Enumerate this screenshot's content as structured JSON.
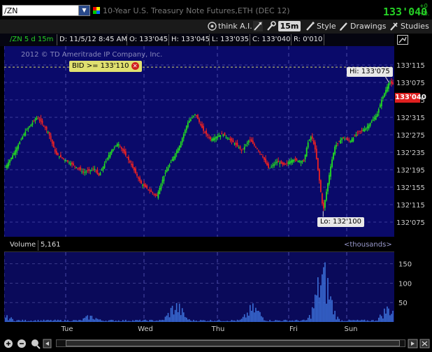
{
  "header": {
    "symbol": "/ZN",
    "description": "10-Year U.S. Treasury Note Futures,ETH (DEC 12)",
    "last_price": "133'040",
    "change_line1": "+0",
    "change_line2": "+0.",
    "price_color": "#25d025"
  },
  "toolbar": {
    "thinkai_label": "think A.I.",
    "timeframe_label": "15m",
    "style_label": "Style",
    "drawings_label": "Drawings",
    "studies_label": "Studies"
  },
  "infobar": {
    "chart_label": "/ZN 5 d 15m",
    "date": "D: 11/5/12 8:45 AM",
    "open": "O: 133'045",
    "high": "H: 133'045",
    "low": "L: 133'035",
    "close": "C: 133'040",
    "range": "R: 0'010"
  },
  "watermark": "2012 © TD Ameritrade IP Company, Inc.",
  "alert": {
    "label": "BID >= 133'110"
  },
  "chart_data": {
    "type": "candlestick",
    "y_ticks": [
      "133'115",
      "133'075",
      "133'035",
      "132'315",
      "132'275",
      "132'235",
      "132'195",
      "132'155",
      "132'115",
      "132'075"
    ],
    "x_labels": [
      "Tue",
      "Wed",
      "Thu",
      "Fri",
      "Sun"
    ],
    "hi_label": "Hi: 133'075",
    "lo_label": "Lo: 132'100",
    "last_label": "133'040",
    "bull_color": "#22dd22",
    "bear_color": "#ee2222",
    "bg_color": "#0a0a6a",
    "path": [
      [
        0,
        132.59
      ],
      [
        2,
        132.66
      ],
      [
        5,
        132.78
      ],
      [
        8,
        132.86
      ],
      [
        9,
        132.84
      ],
      [
        11,
        132.78
      ],
      [
        13,
        132.66
      ],
      [
        16,
        132.62
      ],
      [
        19,
        132.58
      ],
      [
        20,
        132.56
      ],
      [
        23,
        132.58
      ],
      [
        24,
        132.54
      ],
      [
        27,
        132.67
      ],
      [
        29,
        132.72
      ],
      [
        32,
        132.62
      ],
      [
        35,
        132.5
      ],
      [
        39,
        132.43
      ],
      [
        41,
        132.55
      ],
      [
        45,
        132.71
      ],
      [
        47,
        132.83
      ],
      [
        49,
        132.88
      ],
      [
        51,
        132.79
      ],
      [
        53,
        132.74
      ],
      [
        56,
        132.77
      ],
      [
        59,
        132.72
      ],
      [
        61,
        132.68
      ],
      [
        63,
        132.74
      ],
      [
        66,
        132.66
      ],
      [
        68,
        132.58
      ],
      [
        70,
        132.62
      ],
      [
        72,
        132.6
      ],
      [
        74,
        132.63
      ],
      [
        77,
        132.62
      ],
      [
        78,
        132.72
      ],
      [
        79,
        132.76
      ],
      [
        80,
        132.68
      ],
      [
        81,
        132.52
      ],
      [
        82,
        132.35
      ],
      [
        84,
        132.6
      ],
      [
        85,
        132.7
      ],
      [
        87,
        132.75
      ],
      [
        89,
        132.73
      ],
      [
        91,
        132.78
      ],
      [
        93,
        132.8
      ],
      [
        95,
        132.85
      ],
      [
        96,
        132.88
      ],
      [
        97,
        132.95
      ],
      [
        98,
        133.0
      ],
      [
        99,
        133.05
      ],
      [
        100,
        133.04
      ]
    ]
  },
  "volume": {
    "label": "Volume",
    "value": "5,161",
    "units": "<thousands>",
    "y_ticks": [
      "150",
      "100",
      "50"
    ],
    "ymax": 180,
    "session_peaks": [
      [
        0,
        18
      ],
      [
        22,
        20
      ],
      [
        44,
        58
      ],
      [
        64,
        50
      ],
      [
        82,
        170
      ],
      [
        99,
        50
      ]
    ]
  }
}
